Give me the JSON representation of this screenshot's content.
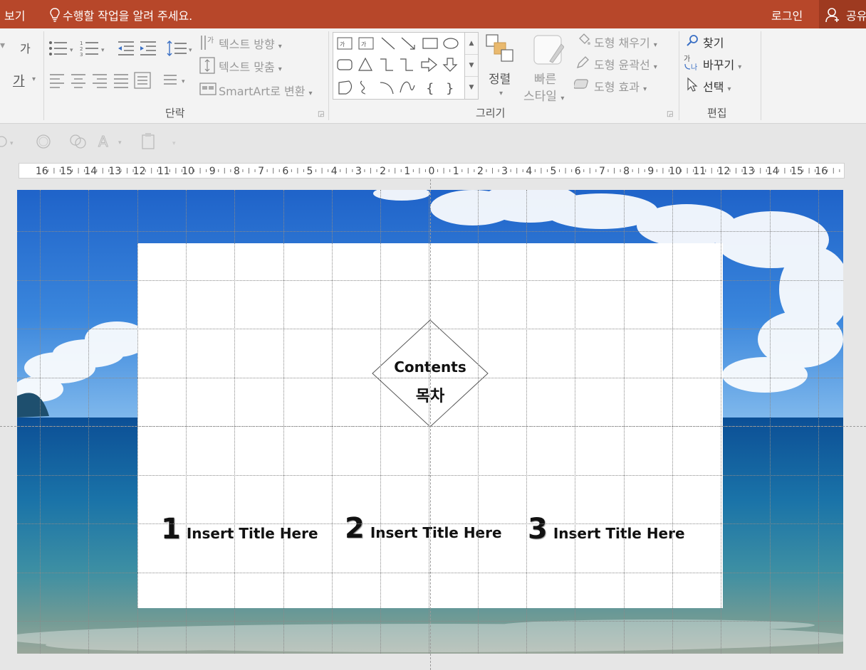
{
  "titlebar": {
    "tab_view": "보기",
    "tell_me": "수행할 작업을 알려 주세요.",
    "login": "로그인",
    "share": "공유"
  },
  "ribbon": {
    "paragraph": {
      "text_direction": "텍스트 방향",
      "align_text": "텍스트 맞춤",
      "convert_smartart": "SmartArt로 변환",
      "group_label": "단락",
      "font_glyph": "가",
      "clear_glyph": "가"
    },
    "drawing": {
      "arrange": "정렬",
      "quick_styles_1": "빠른",
      "quick_styles_2": "스타일",
      "shape_fill": "도형 채우기",
      "shape_outline": "도형 윤곽선",
      "shape_effects": "도형 효과",
      "group_label": "그리기"
    },
    "editing": {
      "find": "찾기",
      "replace": "바꾸기",
      "select": "선택",
      "group_label": "편집"
    }
  },
  "ruler": {
    "labels": [
      "16",
      "15",
      "14",
      "13",
      "12",
      "11",
      "10",
      "9",
      "8",
      "7",
      "6",
      "5",
      "4",
      "3",
      "2",
      "1",
      "0",
      "1",
      "2",
      "3",
      "4",
      "5",
      "6",
      "7",
      "8",
      "9",
      "10",
      "11",
      "12",
      "13",
      "14",
      "15",
      "16"
    ]
  },
  "slide": {
    "center_title_en": "Contents",
    "center_title_ko": "목차",
    "items": [
      {
        "number": "1",
        "title": "Insert Title Here"
      },
      {
        "number": "2",
        "title": "Insert Title Here"
      },
      {
        "number": "3",
        "title": "Insert Title Here"
      }
    ]
  }
}
